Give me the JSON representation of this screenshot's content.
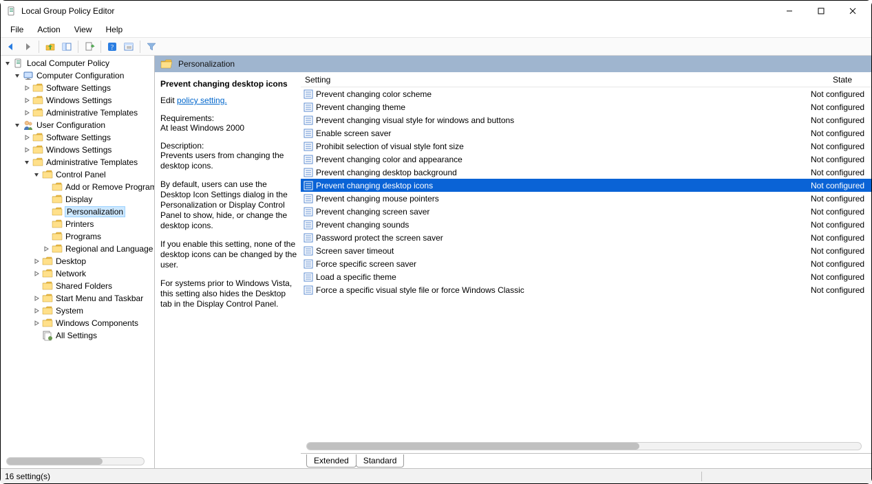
{
  "window": {
    "title": "Local Group Policy Editor"
  },
  "menu": {
    "items": [
      "File",
      "Action",
      "View",
      "Help"
    ]
  },
  "toolbar": {
    "buttons": [
      "back",
      "forward",
      "up",
      "show-hide-tree",
      "export-list",
      "help",
      "properties",
      "filter"
    ]
  },
  "tree": {
    "root": "Local Computer Policy",
    "nodes": [
      {
        "l": 0,
        "exp": "open",
        "icon": "policy",
        "label": "Local Computer Policy"
      },
      {
        "l": 1,
        "exp": "open",
        "icon": "computer",
        "label": "Computer Configuration"
      },
      {
        "l": 2,
        "exp": "closed",
        "icon": "folder",
        "label": "Software Settings"
      },
      {
        "l": 2,
        "exp": "closed",
        "icon": "folder",
        "label": "Windows Settings"
      },
      {
        "l": 2,
        "exp": "closed",
        "icon": "folder",
        "label": "Administrative Templates"
      },
      {
        "l": 1,
        "exp": "open",
        "icon": "user",
        "label": "User Configuration"
      },
      {
        "l": 2,
        "exp": "closed",
        "icon": "folder",
        "label": "Software Settings"
      },
      {
        "l": 2,
        "exp": "closed",
        "icon": "folder",
        "label": "Windows Settings"
      },
      {
        "l": 2,
        "exp": "open",
        "icon": "folder",
        "label": "Administrative Templates"
      },
      {
        "l": 3,
        "exp": "open",
        "icon": "folder",
        "label": "Control Panel"
      },
      {
        "l": 4,
        "exp": "none",
        "icon": "folder",
        "label": "Add or Remove Programs"
      },
      {
        "l": 4,
        "exp": "none",
        "icon": "folder",
        "label": "Display"
      },
      {
        "l": 4,
        "exp": "none",
        "icon": "folder",
        "label": "Personalization",
        "selected": true
      },
      {
        "l": 4,
        "exp": "none",
        "icon": "folder",
        "label": "Printers"
      },
      {
        "l": 4,
        "exp": "none",
        "icon": "folder",
        "label": "Programs"
      },
      {
        "l": 4,
        "exp": "closed",
        "icon": "folder",
        "label": "Regional and Language Options"
      },
      {
        "l": 3,
        "exp": "closed",
        "icon": "folder",
        "label": "Desktop"
      },
      {
        "l": 3,
        "exp": "closed",
        "icon": "folder",
        "label": "Network"
      },
      {
        "l": 3,
        "exp": "none",
        "icon": "folder",
        "label": "Shared Folders"
      },
      {
        "l": 3,
        "exp": "closed",
        "icon": "folder",
        "label": "Start Menu and Taskbar"
      },
      {
        "l": 3,
        "exp": "closed",
        "icon": "folder",
        "label": "System"
      },
      {
        "l": 3,
        "exp": "closed",
        "icon": "folder",
        "label": "Windows Components"
      },
      {
        "l": 3,
        "exp": "none",
        "icon": "allsettings",
        "label": "All Settings"
      }
    ]
  },
  "path": {
    "title": "Personalization"
  },
  "desc": {
    "heading": "Prevent changing desktop icons",
    "edit_prefix": "Edit ",
    "edit_link": "policy setting.",
    "req_label": "Requirements:",
    "req_value": "At least Windows 2000",
    "desc_label": "Description:",
    "p1": "Prevents users from changing the desktop icons.",
    "p2": "By default, users can use the Desktop Icon Settings dialog in the Personalization or Display Control Panel to show, hide, or change the desktop icons.",
    "p3": "If you enable this setting, none of the desktop icons can be changed by the user.",
    "p4": "For systems prior to Windows Vista, this setting also hides the Desktop tab in the Display Control Panel."
  },
  "list": {
    "col_setting": "Setting",
    "col_state": "State",
    "rows": [
      {
        "label": "Prevent changing color scheme",
        "state": "Not configured"
      },
      {
        "label": "Prevent changing theme",
        "state": "Not configured"
      },
      {
        "label": "Prevent changing visual style for windows and buttons",
        "state": "Not configured"
      },
      {
        "label": "Enable screen saver",
        "state": "Not configured"
      },
      {
        "label": "Prohibit selection of visual style font size",
        "state": "Not configured"
      },
      {
        "label": "Prevent changing color and appearance",
        "state": "Not configured"
      },
      {
        "label": "Prevent changing desktop background",
        "state": "Not configured"
      },
      {
        "label": "Prevent changing desktop icons",
        "state": "Not configured",
        "selected": true
      },
      {
        "label": "Prevent changing mouse pointers",
        "state": "Not configured"
      },
      {
        "label": "Prevent changing screen saver",
        "state": "Not configured"
      },
      {
        "label": "Prevent changing sounds",
        "state": "Not configured"
      },
      {
        "label": "Password protect the screen saver",
        "state": "Not configured"
      },
      {
        "label": "Screen saver timeout",
        "state": "Not configured"
      },
      {
        "label": "Force specific screen saver",
        "state": "Not configured"
      },
      {
        "label": "Load a specific theme",
        "state": "Not configured"
      },
      {
        "label": "Force a specific visual style file or force Windows Classic",
        "state": "Not configured"
      }
    ]
  },
  "tabs": {
    "extended": "Extended",
    "standard": "Standard"
  },
  "status": {
    "text": "16 setting(s)"
  }
}
